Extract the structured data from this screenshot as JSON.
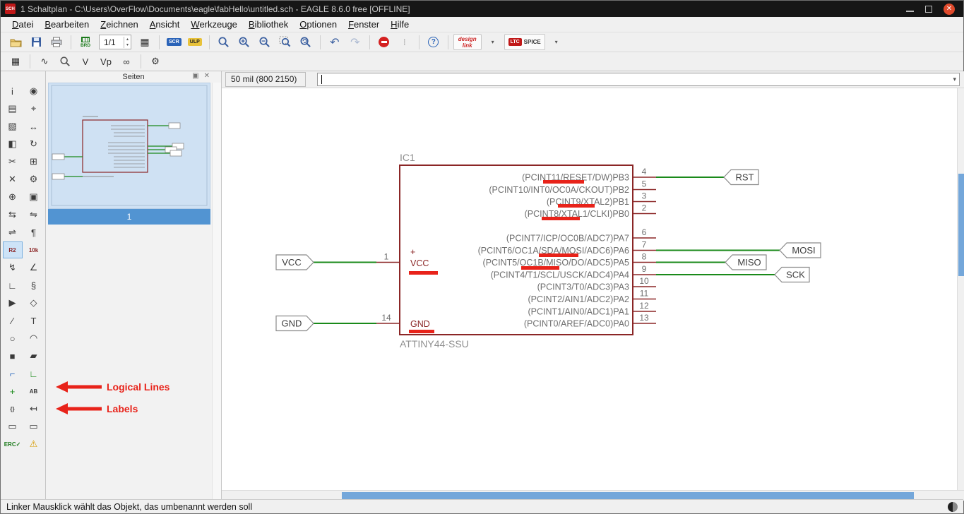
{
  "window": {
    "icon_label": "SCH",
    "title": "1 Schaltplan - C:\\Users\\OverFlow\\Documents\\eagle\\fabHello\\untitled.sch - EAGLE 8.6.0 free [OFFLINE]"
  },
  "menubar": [
    "Datei",
    "Bearbeiten",
    "Zeichnen",
    "Ansicht",
    "Werkzeuge",
    "Bibliothek",
    "Optionen",
    "Fenster",
    "Hilfe"
  ],
  "toolbar": {
    "brd": "BRD",
    "sheet": "1/1",
    "scr": "SCR",
    "ulp": "ULP",
    "designlink_top": "design",
    "designlink_bottom": "link",
    "ltc": "LTC",
    "spice": "SPICE",
    "help": "?",
    "v": "V",
    "vp": "Vp"
  },
  "command_bar": {
    "coords": "50 mil (800 2150)",
    "value": ""
  },
  "pages": {
    "title": "Seiten",
    "selected_page": "1"
  },
  "palette": {
    "tools": [
      {
        "id": "info",
        "glyph": "i"
      },
      {
        "id": "show",
        "glyph": "◉"
      },
      {
        "id": "display",
        "glyph": "▤"
      },
      {
        "id": "mark",
        "glyph": "⌖"
      },
      {
        "id": "group",
        "glyph": "▧"
      },
      {
        "id": "move",
        "glyph": "↔"
      },
      {
        "id": "mirror",
        "glyph": "◧"
      },
      {
        "id": "rotate",
        "glyph": "↻"
      },
      {
        "id": "cut",
        "glyph": "✂"
      },
      {
        "id": "copy",
        "glyph": "⊞"
      },
      {
        "id": "delete",
        "glyph": "✕"
      },
      {
        "id": "change",
        "glyph": "⚙"
      },
      {
        "id": "add-part",
        "glyph": "⊕"
      },
      {
        "id": "paste",
        "glyph": "▣"
      },
      {
        "id": "pinswap",
        "glyph": "⇆"
      },
      {
        "id": "gateswap",
        "glyph": "⇋"
      },
      {
        "id": "replace",
        "glyph": "⇌"
      },
      {
        "id": "richtext",
        "glyph": "¶"
      },
      {
        "id": "name",
        "glyph": "R2",
        "selected": true,
        "small": true,
        "color": "#8b2626"
      },
      {
        "id": "value",
        "glyph": "10k",
        "small": true,
        "color": "#8b2626"
      },
      {
        "id": "smash",
        "glyph": "↯"
      },
      {
        "id": "miter",
        "glyph": "∠"
      },
      {
        "id": "split",
        "glyph": "∟"
      },
      {
        "id": "invoke",
        "glyph": "§"
      },
      {
        "id": "arrow",
        "glyph": "▶"
      },
      {
        "id": "tag",
        "glyph": "◇"
      },
      {
        "id": "wire",
        "glyph": "∕"
      },
      {
        "id": "text",
        "glyph": "T"
      },
      {
        "id": "circle",
        "glyph": "○"
      },
      {
        "id": "arc",
        "glyph": "◠"
      },
      {
        "id": "rect",
        "glyph": "■"
      },
      {
        "id": "polygon",
        "glyph": "▰"
      },
      {
        "id": "bus",
        "glyph": "⌐",
        "color": "#2d6bbf"
      },
      {
        "id": "net",
        "glyph": "∟",
        "color": "#1a8a1a"
      },
      {
        "id": "junction",
        "glyph": "+",
        "color": "#1a8a1a"
      },
      {
        "id": "label",
        "glyph": "AB",
        "small": true
      },
      {
        "id": "attribute",
        "glyph": "{}",
        "small": true
      },
      {
        "id": "dimension",
        "glyph": "↤"
      },
      {
        "id": "frame",
        "glyph": "▭"
      },
      {
        "id": "module",
        "glyph": "▭"
      },
      {
        "id": "erc",
        "glyph": "ERC✓",
        "small": true,
        "color": "#1b7a1b"
      },
      {
        "id": "errors",
        "glyph": "⚠",
        "color": "#d79b00"
      }
    ]
  },
  "schematic": {
    "ref": "IC1",
    "value": "ATTINY44-SSU",
    "plus": "+",
    "left_pins": [
      {
        "number": "1",
        "label": "VCC",
        "net": "VCC"
      },
      {
        "number": "14",
        "label": "GND",
        "net": "GND"
      }
    ],
    "right_pins": [
      {
        "number": "4",
        "label": "(PCINT11/RESET/DW)PB3",
        "net": "RST"
      },
      {
        "number": "5",
        "label": "(PCINT10/INT0/OC0A/CKOUT)PB2",
        "net": ""
      },
      {
        "number": "3",
        "label": "(PCINT9/XTAL2)PB1",
        "net": ""
      },
      {
        "number": "2",
        "label": "(PCINT8/XTAL1/CLKI)PB0",
        "net": ""
      },
      {
        "number": "6",
        "label": "(PCINT7/ICP/OC0B/ADC7)PA7",
        "net": ""
      },
      {
        "number": "7",
        "label": "(PCINT6/OC1A/SDA/MOSI/ADC6)PA6",
        "net": "MOSI"
      },
      {
        "number": "8",
        "label": "(PCINT5/OC1B/MISO/DO/ADC5)PA5",
        "net": "MISO"
      },
      {
        "number": "9",
        "label": "(PCINT4/T1/SCL/USCK/ADC4)PA4",
        "net": "SCK"
      },
      {
        "number": "10",
        "label": "(PCINT3/T0/ADC3)PA3",
        "net": ""
      },
      {
        "number": "11",
        "label": "(PCINT2/AIN1/ADC2)PA2",
        "net": ""
      },
      {
        "number": "12",
        "label": "(PCINT1/AIN0/ADC1)PA1",
        "net": ""
      },
      {
        "number": "13",
        "label": "(PCINT0/AREF/ADC0)PA0",
        "net": ""
      }
    ]
  },
  "annotations": {
    "logical_lines": "Logical Lines",
    "labels": "Labels"
  },
  "statusbar": {
    "text": "Linker Mausklick wählt das Objekt, das umbenannt werden soll"
  },
  "colors": {
    "symbol_red": "#8b2626",
    "wire_green": "#1a8a1a",
    "highlight_red": "#e8231a",
    "accent_blue": "#5a9fd4",
    "flag_stroke": "#8a8a8a"
  }
}
